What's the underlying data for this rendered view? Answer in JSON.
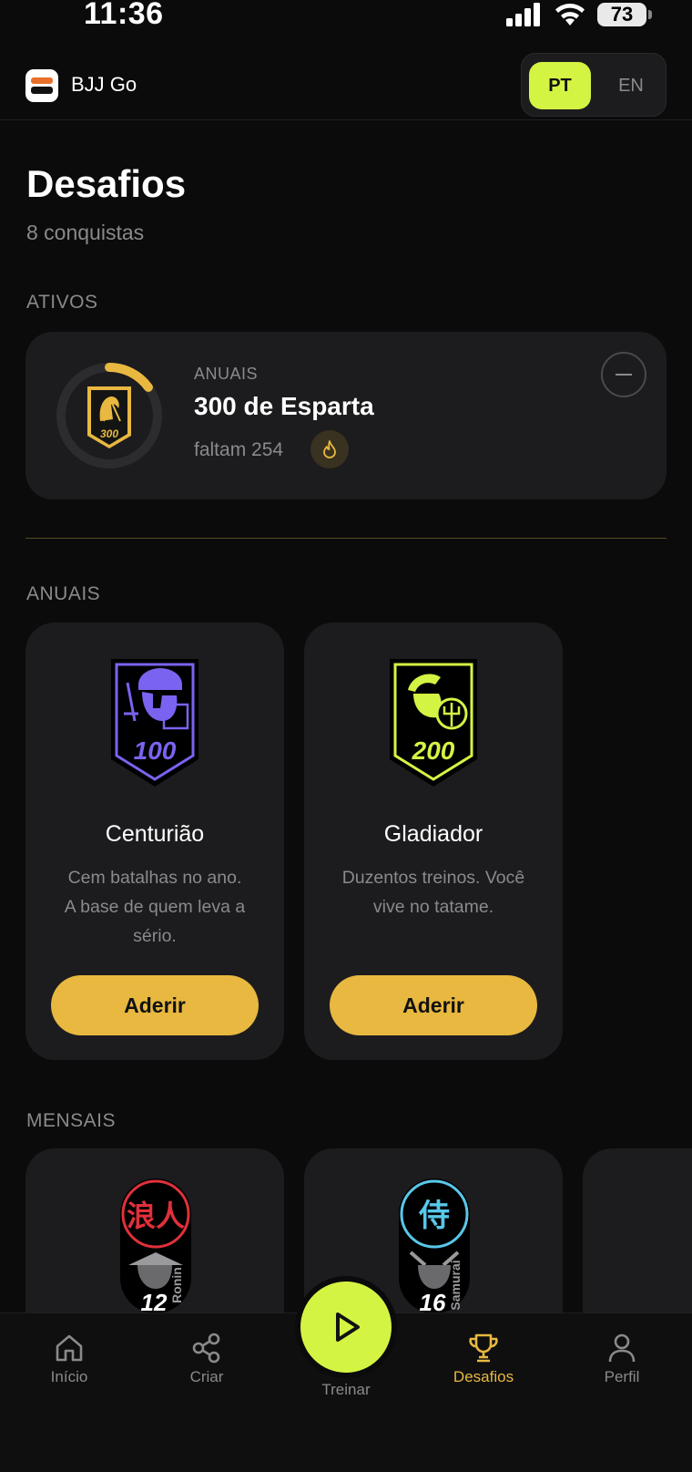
{
  "status_bar": {
    "time": "11:36",
    "battery": "73"
  },
  "header": {
    "app_name": "BJJ Go",
    "lang_pt": "PT",
    "lang_en": "EN"
  },
  "page": {
    "title": "Desafios",
    "subtitle": "8 conquistas"
  },
  "active_section": {
    "label": "ATIVOS",
    "card": {
      "period": "ANUAIS",
      "name": "300 de Esparta",
      "remaining": "faltam 254",
      "badge_number": "300",
      "progress": 0.15
    }
  },
  "annual_section": {
    "label": "ANUAIS",
    "cards": [
      {
        "name": "Centurião",
        "desc_lines": [
          "Cem batalhas no ano.",
          "A base de quem leva a",
          "sério."
        ],
        "badge_number": "100",
        "button": "Aderir",
        "accent": "#7a63f0"
      },
      {
        "name": "Gladiador",
        "desc_lines": [
          "Duzentos treinos. Você",
          "vive no tatame."
        ],
        "badge_number": "200",
        "button": "Aderir",
        "accent": "#d4f444"
      }
    ]
  },
  "monthly_section": {
    "label": "MENSAIS",
    "cards": [
      {
        "kanji": "浪人",
        "side_text": "Ronin",
        "badge_number": "12",
        "accent": "#e0303a"
      },
      {
        "kanji": "侍",
        "side_text": "Samurai",
        "badge_number": "16",
        "accent": "#58c8e8"
      }
    ]
  },
  "nav": {
    "home": "Início",
    "create": "Criar",
    "train": "Treinar",
    "challenges": "Desafios",
    "profile": "Perfil",
    "active_color": "#e8b840"
  }
}
